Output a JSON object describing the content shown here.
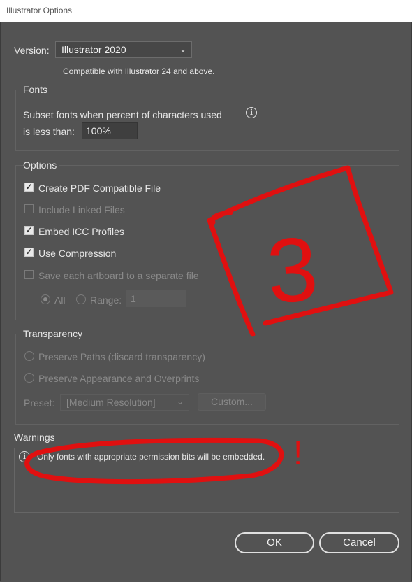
{
  "window": {
    "title": "Illustrator Options"
  },
  "version": {
    "label": "Version:",
    "selected": "Illustrator 2020",
    "compat_note": "Compatible with Illustrator 24 and above."
  },
  "fonts": {
    "group_title": "Fonts",
    "subset_label_line1": "Subset fonts when percent of characters used",
    "subset_label_line2": "is less than:",
    "subset_value": "100%"
  },
  "options": {
    "group_title": "Options",
    "items": [
      {
        "label": "Create PDF Compatible File",
        "checked": true,
        "enabled": true
      },
      {
        "label": "Include Linked Files",
        "checked": false,
        "enabled": false
      },
      {
        "label": "Embed ICC Profiles",
        "checked": true,
        "enabled": true
      },
      {
        "label": "Use Compression",
        "checked": true,
        "enabled": true
      },
      {
        "label": "Save each artboard to a separate file",
        "checked": false,
        "enabled": false
      }
    ],
    "all_label": "All",
    "range_label": "Range:",
    "range_value": "1"
  },
  "transparency": {
    "group_title": "Transparency",
    "preserve_paths": "Preserve Paths (discard transparency)",
    "preserve_appearance": "Preserve Appearance and Overprints",
    "preset_label": "Preset:",
    "preset_value": "[Medium Resolution]",
    "custom_button": "Custom..."
  },
  "warnings": {
    "group_title": "Warnings",
    "message": "Only fonts with appropriate permission bits will be embedded."
  },
  "buttons": {
    "ok": "OK",
    "cancel": "Cancel"
  },
  "annotations": {
    "number": "3",
    "exclamation": "!"
  },
  "colors": {
    "annotation_red": "#e01010",
    "dialog_bg": "#535353"
  }
}
